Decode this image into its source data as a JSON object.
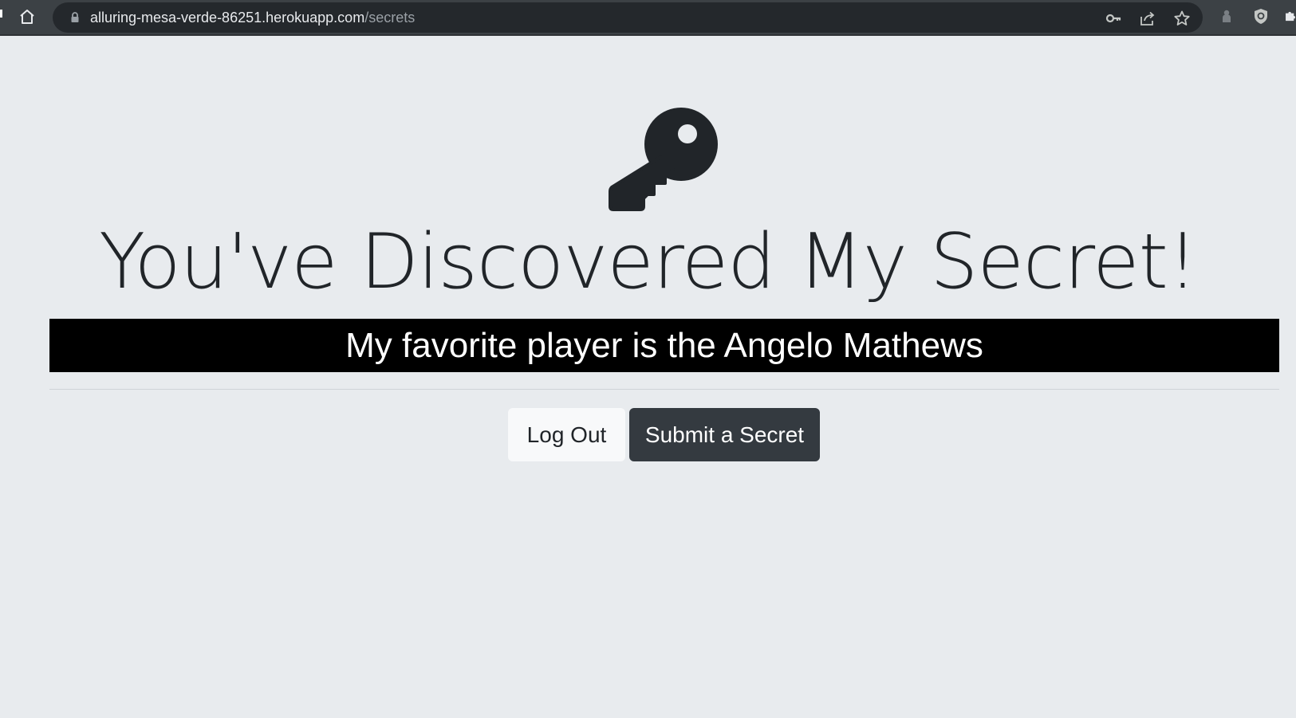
{
  "browser": {
    "url_host": "alluring-mesa-verde-86251.herokuapp.com",
    "url_path": "/secrets",
    "icons": [
      "home-icon",
      "lock-icon",
      "key-icon",
      "share-icon",
      "star-icon",
      "profile-icon",
      "shield-icon",
      "puzzle-icon"
    ]
  },
  "page": {
    "title": "You've Discovered My Secret!",
    "secret": "My favorite player is the Angelo Mathews",
    "logout_label": "Log Out",
    "submit_label": "Submit a Secret",
    "colors": {
      "background": "#e8ebee",
      "text": "#212529",
      "secret_bg": "#000000",
      "btn_dark": "#343a40",
      "btn_light": "#f8f9fa"
    }
  }
}
